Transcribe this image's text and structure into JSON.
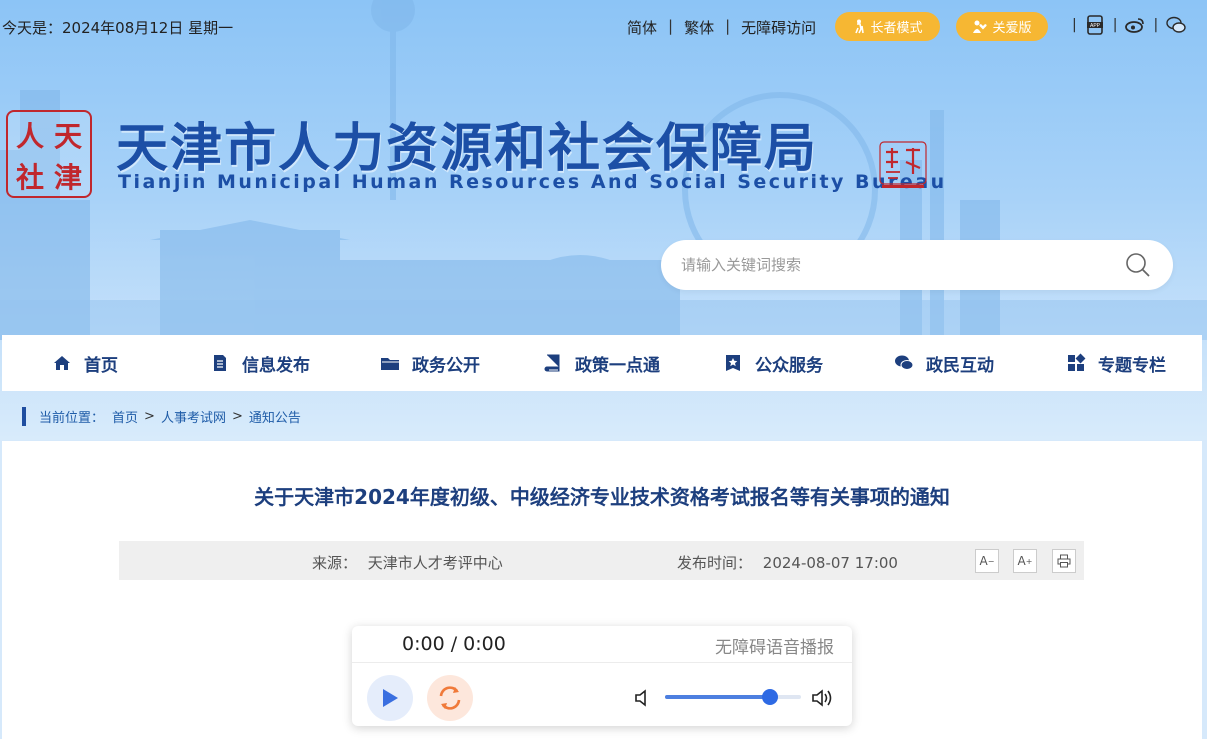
{
  "topbar": {
    "date": "今天是：2024年08月12日 星期一",
    "lang_simplified": "简体",
    "lang_traditional": "繁体",
    "accessible": "无障碍访问",
    "elder_mode": "长者模式",
    "care_version": "关爱版"
  },
  "header": {
    "seal_chars": [
      "人",
      "天",
      "社",
      "津"
    ],
    "title": "天津市人力资源和社会保障局",
    "subtitle": "Tianjin Municipal Human Resources And Social Security Bureau"
  },
  "search": {
    "placeholder": "请输入关键词搜索"
  },
  "nav": [
    {
      "label": "首页",
      "icon": "home-icon"
    },
    {
      "label": "信息发布",
      "icon": "document-icon"
    },
    {
      "label": "政务公开",
      "icon": "folder-icon"
    },
    {
      "label": "政策一点通",
      "icon": "book-icon"
    },
    {
      "label": "公众服务",
      "icon": "star-badge-icon"
    },
    {
      "label": "政民互动",
      "icon": "chat-icon"
    },
    {
      "label": "专题专栏",
      "icon": "grid-icon"
    }
  ],
  "breadcrumb": {
    "prefix": "当前位置：",
    "items": [
      "首页",
      "人事考试网",
      "通知公告"
    ],
    "separator": ">"
  },
  "article": {
    "title": "关于天津市2024年度初级、中级经济专业技术资格考试报名等有关事项的通知",
    "source_label": "来源：",
    "source": "天津市人才考评中心",
    "time_label": "发布时间：",
    "time": "2024-08-07 17:00",
    "font_decrease": "A",
    "font_increase": "A"
  },
  "player": {
    "current": "0:00",
    "separator": "/",
    "duration": "0:00",
    "label": "无障碍语音播报",
    "volume": 0.77
  },
  "colors": {
    "brand_blue": "#1c4fa6",
    "nav_text": "#1d3f7e",
    "pill_yellow": "#f6b733",
    "seal_red": "#c0272d"
  }
}
